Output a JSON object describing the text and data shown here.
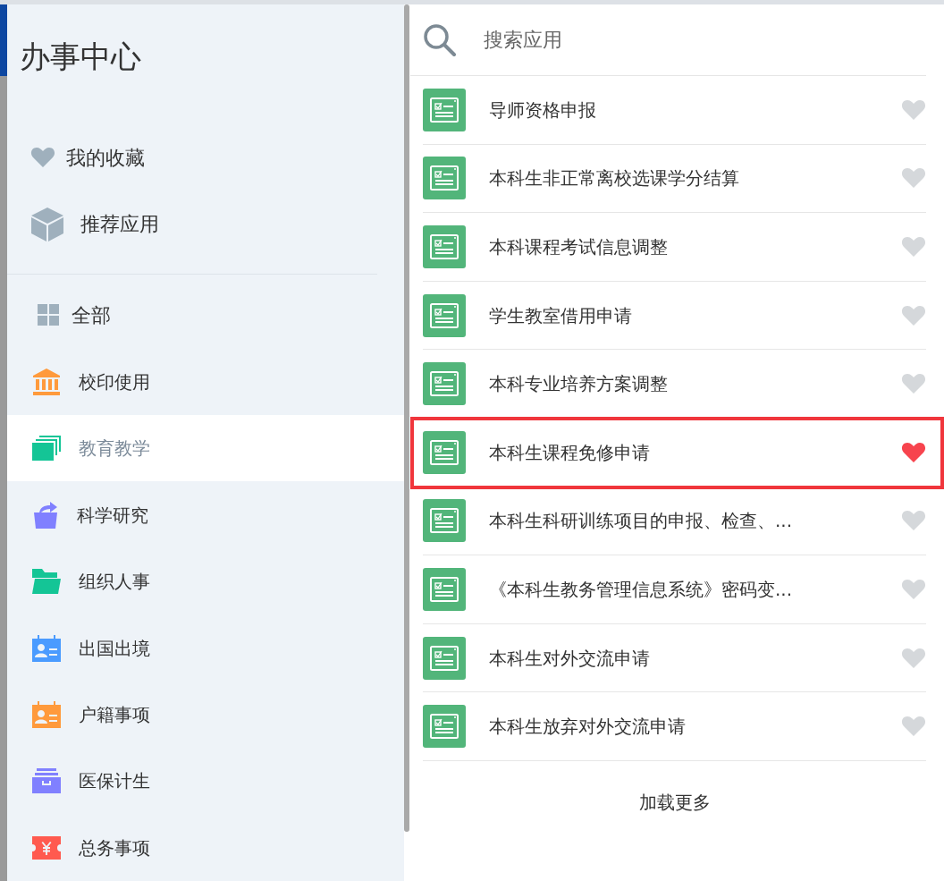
{
  "sidebar": {
    "title": "办事中心",
    "shortcuts": [
      {
        "kind": "heart",
        "label": "我的收藏"
      },
      {
        "kind": "cube",
        "label": "推荐应用"
      }
    ],
    "all": {
      "label": "全部"
    },
    "categories": [
      {
        "kind": "bank",
        "color": "#ff9a3c",
        "label": "校印使用",
        "selected": false
      },
      {
        "kind": "cards",
        "color": "#14c596",
        "label": "教育教学",
        "selected": true
      },
      {
        "kind": "share",
        "color": "#8080ff",
        "label": "科学研究",
        "selected": false
      },
      {
        "kind": "folder",
        "color": "#14c596",
        "label": "组织人事",
        "selected": false
      },
      {
        "kind": "idcard",
        "color": "#4a9bff",
        "label": "出国出境",
        "selected": false
      },
      {
        "kind": "idcard",
        "color": "#ff9a3c",
        "label": "户籍事项",
        "selected": false
      },
      {
        "kind": "box",
        "color": "#8080ff",
        "label": "医保计生",
        "selected": false
      },
      {
        "kind": "ticket",
        "color": "#ff5a4f",
        "label": "总务事项",
        "selected": false
      }
    ]
  },
  "search": {
    "placeholder": "搜索应用"
  },
  "apps": [
    {
      "name": "导师资格申报",
      "favorite": false,
      "highlighted": false
    },
    {
      "name": "本科生非正常离校选课学分结算",
      "favorite": false,
      "highlighted": false
    },
    {
      "name": "本科课程考试信息调整",
      "favorite": false,
      "highlighted": false
    },
    {
      "name": "学生教室借用申请",
      "favorite": false,
      "highlighted": false
    },
    {
      "name": "本科专业培养方案调整",
      "favorite": false,
      "highlighted": false
    },
    {
      "name": "本科生课程免修申请",
      "favorite": true,
      "highlighted": true
    },
    {
      "name": "本科生科研训练项目的申报、检查、...",
      "favorite": false,
      "highlighted": false
    },
    {
      "name": "《本科生教务管理信息系统》密码变...",
      "favorite": false,
      "highlighted": false
    },
    {
      "name": "本科生对外交流申请",
      "favorite": false,
      "highlighted": false
    },
    {
      "name": "本科生放弃对外交流申请",
      "favorite": false,
      "highlighted": false
    }
  ],
  "load_more": "加载更多"
}
